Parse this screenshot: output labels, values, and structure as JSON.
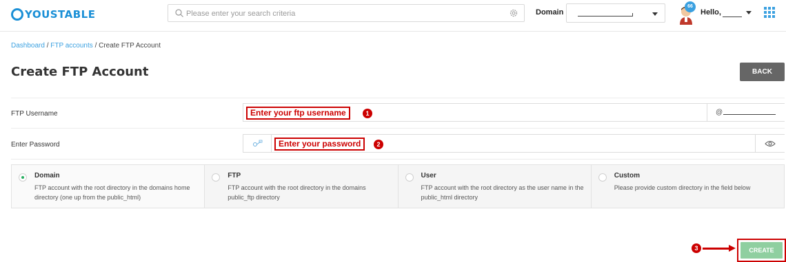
{
  "header": {
    "logo_text": "YOUSTABLE",
    "search_placeholder": "Please enter your search criteria",
    "domain_label": "Domain",
    "notification_count": "66",
    "greeting": "Hello,"
  },
  "breadcrumb": {
    "items": [
      "Dashboard",
      "FTP accounts",
      "Create FTP Account"
    ],
    "separator": "/"
  },
  "page": {
    "title": "Create FTP Account",
    "back_label": "BACK"
  },
  "form": {
    "username_label": "FTP Username",
    "username_annotation": "Enter your ftp username",
    "username_suffix": "@",
    "password_label": "Enter Password",
    "password_annotation": "Enter your password"
  },
  "options": [
    {
      "title": "Domain",
      "description": "FTP account with the root directory in the domains home directory (one up from the public_html)",
      "checked": true
    },
    {
      "title": "FTP",
      "description": "FTP account with the root directory in the domains public_ftp directory",
      "checked": false
    },
    {
      "title": "User",
      "description": "FTP account with the root directory as the user name in the public_html directory",
      "checked": false
    },
    {
      "title": "Custom",
      "description": "Please provide custom directory in the field below",
      "checked": false
    }
  ],
  "annotations": {
    "step1": "1",
    "step2": "2",
    "step3": "3"
  },
  "actions": {
    "create_label": "CREATE"
  },
  "colors": {
    "accent": "#3aa0e0",
    "annotation_red": "#cc0000",
    "create_green": "#8fcfa0",
    "back_gray": "#666666"
  }
}
